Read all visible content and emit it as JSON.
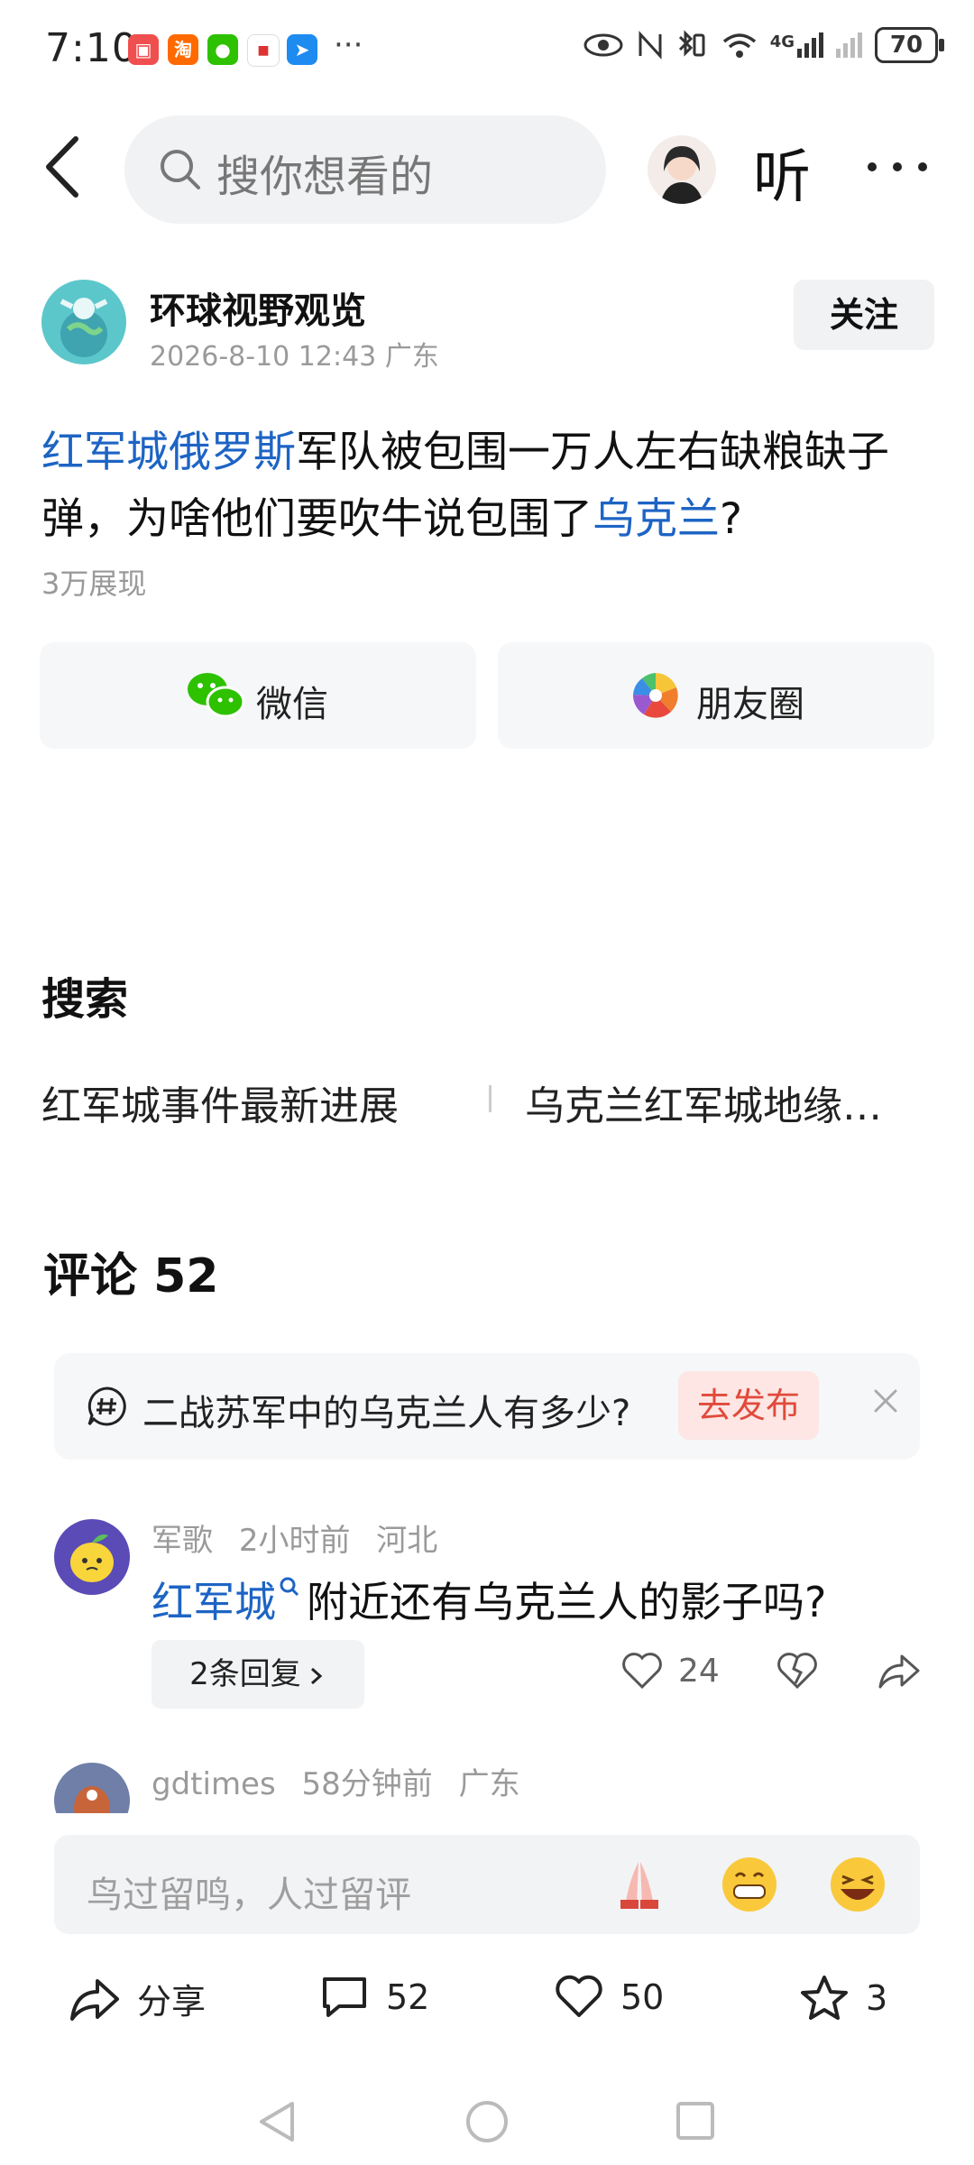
{
  "status_bar": {
    "time": "7:10",
    "network": "4G",
    "battery": "70",
    "more": "···",
    "app_icons": [
      {
        "name": "app-red-icon",
        "color": "#f04f4f"
      },
      {
        "name": "taobao-icon",
        "color": "#ff6a00",
        "glyph": "淘"
      },
      {
        "name": "wechat-icon",
        "color": "#2dc100"
      },
      {
        "name": "app-news-icon",
        "color": "#ffffff"
      },
      {
        "name": "app-blue-icon",
        "color": "#1d8bf0"
      }
    ]
  },
  "top_nav": {
    "search_placeholder": "搜你想看的",
    "listen_label": "听"
  },
  "author": {
    "name": "环球视野观览",
    "meta": "2026-8-10 12:43 广东",
    "follow_label": "关注"
  },
  "article": {
    "title_link1": "红军城俄罗斯",
    "title_mid": "军队被包围一万人左右缺粮缺子弹，为啥他们要吹牛说包围了",
    "title_link2": "乌克兰",
    "title_end": "?",
    "views": "3万展现"
  },
  "share": {
    "wechat_label": "微信",
    "moments_label": "朋友圈"
  },
  "search_section": {
    "title": "搜索",
    "items": [
      "红军城事件最新进展",
      "乌克兰红军城地缘…"
    ]
  },
  "comments_section": {
    "title": "评论 52",
    "topic": {
      "text": "二战苏军中的乌克兰人有多少?",
      "button": "去发布"
    },
    "comments": [
      {
        "user": "军歌",
        "time": "2小时前",
        "location": "河北",
        "link_text": "红军城",
        "text": "附近还有乌克兰人的影子吗?",
        "replies_label": "2条回复",
        "likes": "24"
      },
      {
        "user": "gdtimes",
        "time": "58分钟前",
        "location": "广东"
      }
    ]
  },
  "comment_input": {
    "placeholder": "鸟过留鸣，人过留评"
  },
  "bottom_bar": {
    "share_label": "分享",
    "comment_count": "52",
    "like_count": "50",
    "favorite_count": "3"
  },
  "colors": {
    "link": "#1d64c4",
    "accent_red": "#e14a3b",
    "muted": "#9a9a9a"
  }
}
